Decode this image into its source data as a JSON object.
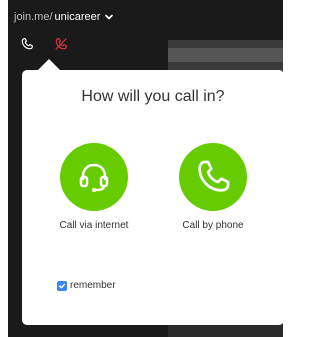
{
  "header": {
    "domain": "join.me/",
    "username": "unicareer"
  },
  "icons": {
    "call_in": "phone-call-icon",
    "mute": "mute-icon"
  },
  "popup": {
    "title": "How will you call in?",
    "options": [
      {
        "label": "Call via internet",
        "icon": "headset-icon"
      },
      {
        "label": "Call by phone",
        "icon": "phone-icon"
      }
    ],
    "remember": {
      "label": "remember",
      "checked": true
    }
  },
  "colors": {
    "accent_green": "#66cc00",
    "mute_red": "#e0363b",
    "checkbox_blue": "#3b82f6"
  }
}
